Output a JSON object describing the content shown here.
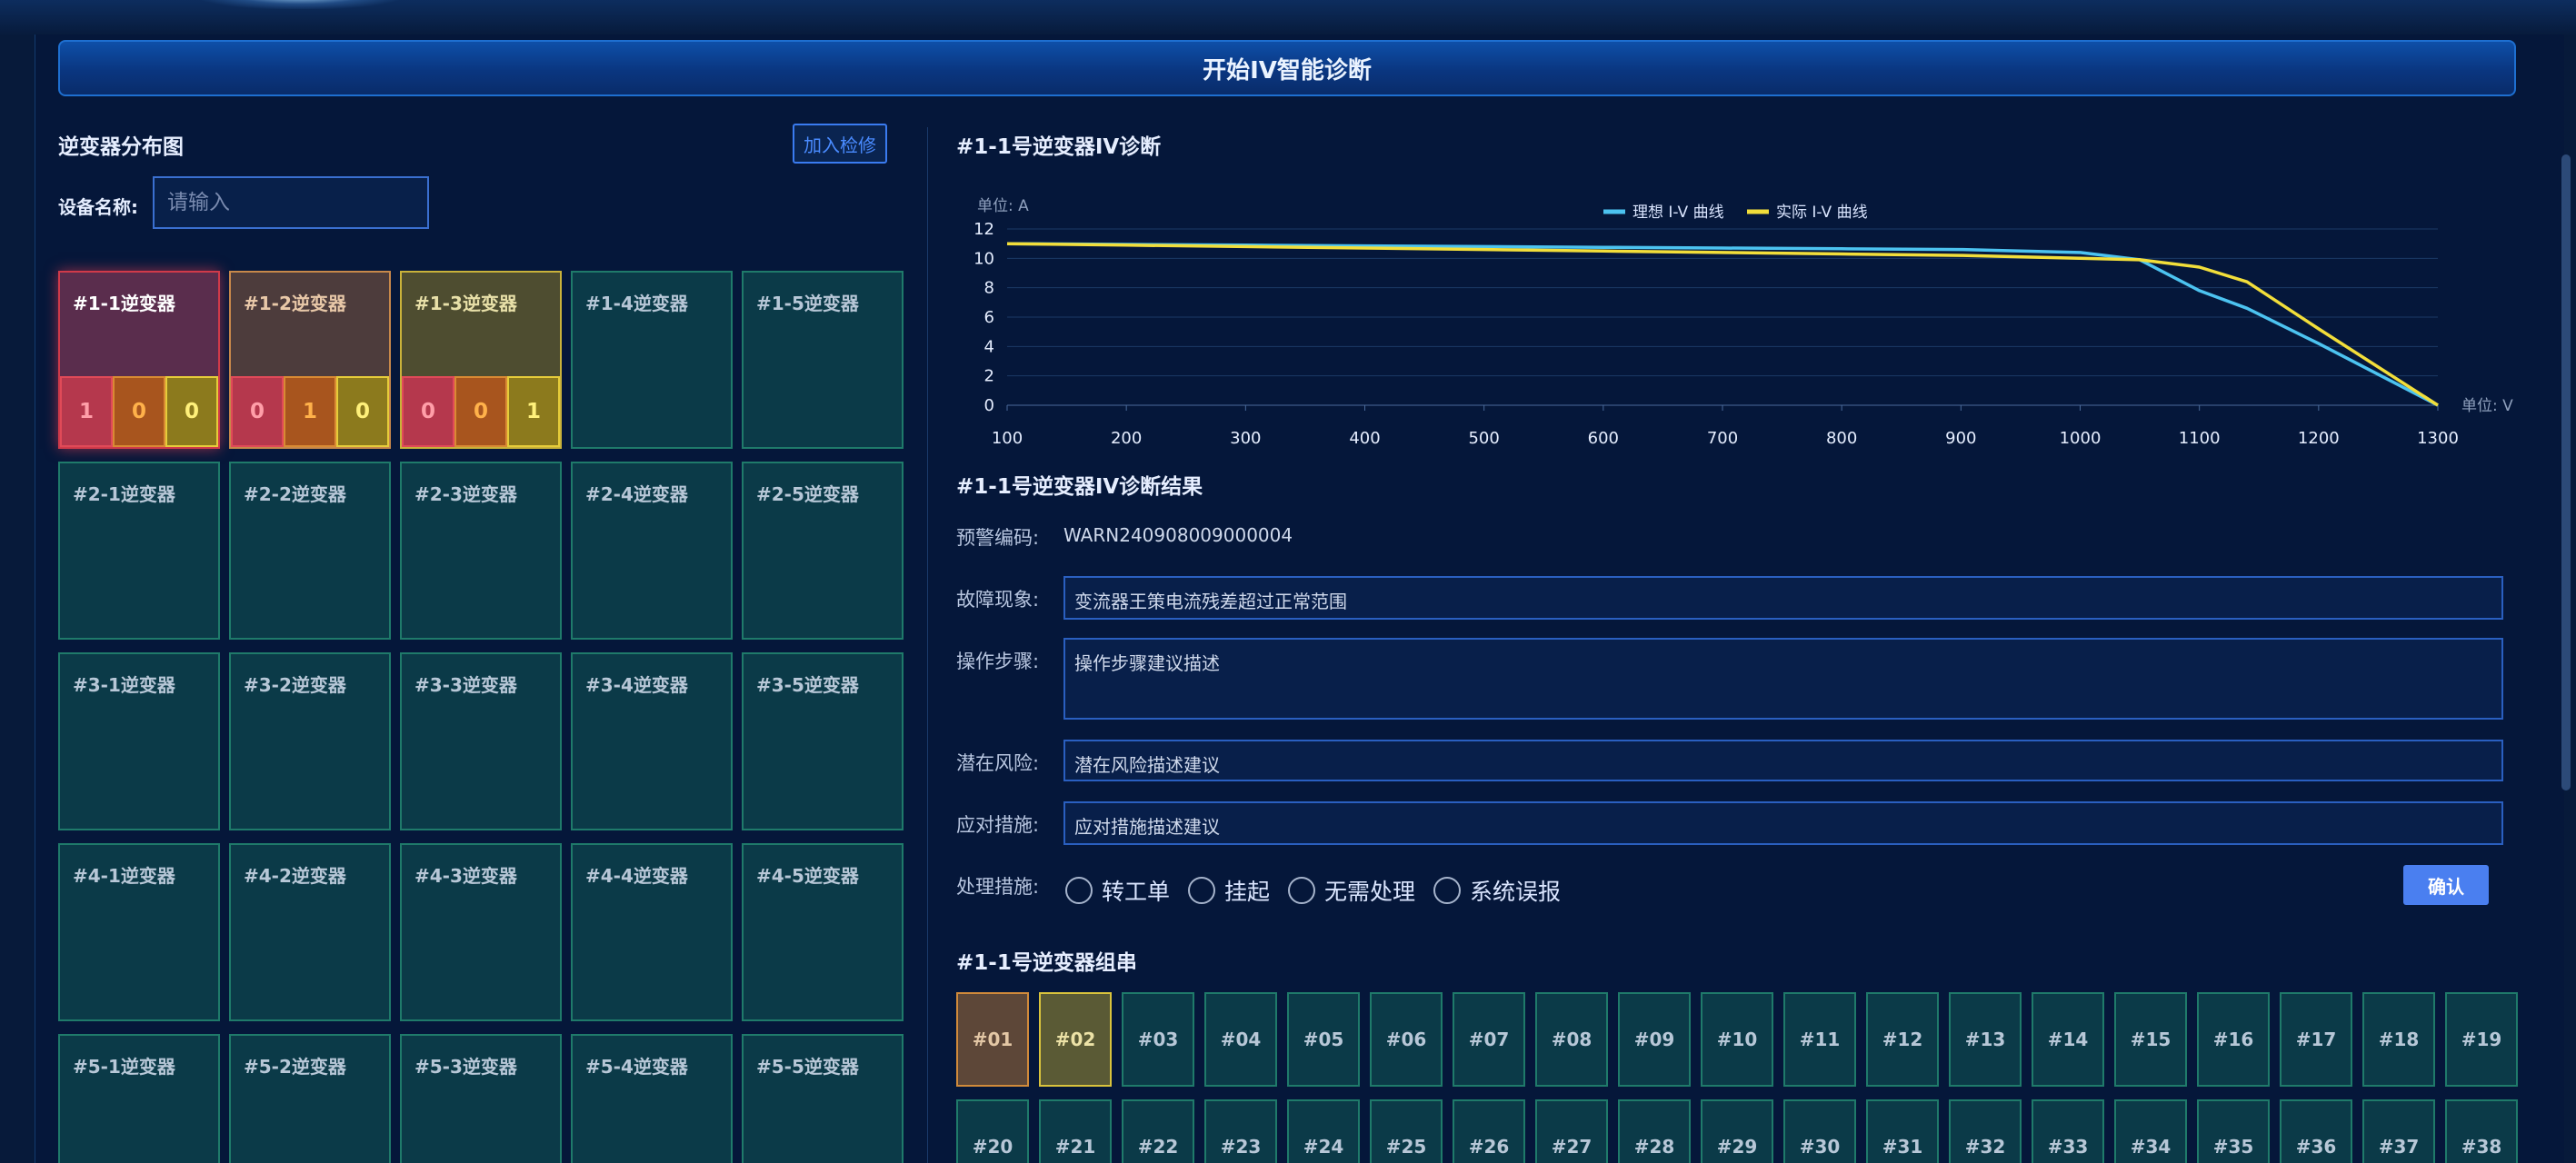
{
  "header": {
    "title": "开始IV智能诊断"
  },
  "left": {
    "title": "逆变器分布图",
    "repair_button": "加入检修",
    "device_label": "设备名称:",
    "device_placeholder": "请输入",
    "inverters": [
      {
        "label": "#1-1逆变器",
        "status": "red",
        "counts": [
          "1",
          "0",
          "0"
        ]
      },
      {
        "label": "#1-2逆变器",
        "status": "orange",
        "counts": [
          "0",
          "1",
          "0"
        ]
      },
      {
        "label": "#1-3逆变器",
        "status": "yellow",
        "counts": [
          "0",
          "0",
          "1"
        ]
      },
      {
        "label": "#1-4逆变器",
        "status": "normal"
      },
      {
        "label": "#1-5逆变器",
        "status": "normal"
      },
      {
        "label": "#2-1逆变器",
        "status": "normal"
      },
      {
        "label": "#2-2逆变器",
        "status": "normal"
      },
      {
        "label": "#2-3逆变器",
        "status": "normal"
      },
      {
        "label": "#2-4逆变器",
        "status": "normal"
      },
      {
        "label": "#2-5逆变器",
        "status": "normal"
      },
      {
        "label": "#3-1逆变器",
        "status": "normal"
      },
      {
        "label": "#3-2逆变器",
        "status": "normal"
      },
      {
        "label": "#3-3逆变器",
        "status": "normal"
      },
      {
        "label": "#3-4逆变器",
        "status": "normal"
      },
      {
        "label": "#3-5逆变器",
        "status": "normal"
      },
      {
        "label": "#4-1逆变器",
        "status": "normal"
      },
      {
        "label": "#4-2逆变器",
        "status": "normal"
      },
      {
        "label": "#4-3逆变器",
        "status": "normal"
      },
      {
        "label": "#4-4逆变器",
        "status": "normal"
      },
      {
        "label": "#4-5逆变器",
        "status": "normal"
      },
      {
        "label": "#5-1逆变器",
        "status": "normal"
      },
      {
        "label": "#5-2逆变器",
        "status": "normal"
      },
      {
        "label": "#5-3逆变器",
        "status": "normal"
      },
      {
        "label": "#5-4逆变器",
        "status": "normal"
      },
      {
        "label": "#5-5逆变器",
        "status": "normal"
      }
    ]
  },
  "right": {
    "diag_title": "#1-1号逆变器IV诊断",
    "result_title": "#1-1号逆变器IV诊断结果",
    "strings_title": "#1-1号逆变器组串",
    "warning_code_label": "预警编码:",
    "warning_code": "WARN240908009000004",
    "fault_label": "故障现象:",
    "fault_value": "变流器王策电流残差超过正常范围",
    "steps_label": "操作步骤:",
    "steps_value": "操作步骤建议描述",
    "risk_label": "潜在风险:",
    "risk_value": "潜在风险描述建议",
    "measure_label": "应对措施:",
    "measure_value": "应对措施描述建议",
    "handle_label": "处理措施:",
    "handle_options": [
      "转工单",
      "挂起",
      "无需处理",
      "系统误报"
    ],
    "confirm_button": "确认",
    "strings": [
      {
        "label": "#01",
        "status": "orange"
      },
      {
        "label": "#02",
        "status": "yellow"
      },
      {
        "label": "#03"
      },
      {
        "label": "#04"
      },
      {
        "label": "#05"
      },
      {
        "label": "#06"
      },
      {
        "label": "#07"
      },
      {
        "label": "#08"
      },
      {
        "label": "#09"
      },
      {
        "label": "#10"
      },
      {
        "label": "#11"
      },
      {
        "label": "#12"
      },
      {
        "label": "#13"
      },
      {
        "label": "#14"
      },
      {
        "label": "#15"
      },
      {
        "label": "#16"
      },
      {
        "label": "#17"
      },
      {
        "label": "#18"
      },
      {
        "label": "#19"
      },
      {
        "label": "#20"
      },
      {
        "label": "#21"
      },
      {
        "label": "#22"
      },
      {
        "label": "#23"
      },
      {
        "label": "#24"
      },
      {
        "label": "#25"
      },
      {
        "label": "#26"
      },
      {
        "label": "#27"
      },
      {
        "label": "#28"
      },
      {
        "label": "#29"
      },
      {
        "label": "#30"
      },
      {
        "label": "#31"
      },
      {
        "label": "#32"
      },
      {
        "label": "#33"
      },
      {
        "label": "#34"
      },
      {
        "label": "#35"
      },
      {
        "label": "#36"
      },
      {
        "label": "#37"
      },
      {
        "label": "#38"
      }
    ]
  },
  "chart_data": {
    "type": "line",
    "ylabel": "单位: A",
    "xlabel": "单位: V",
    "x": [
      100,
      200,
      300,
      400,
      500,
      600,
      700,
      800,
      900,
      1000,
      1050,
      1100,
      1140,
      1200,
      1300
    ],
    "xticks": [
      100,
      200,
      300,
      400,
      500,
      600,
      700,
      800,
      900,
      1000,
      1100,
      1200,
      1300
    ],
    "yticks": [
      0,
      2,
      4,
      6,
      8,
      10,
      12
    ],
    "xlim": [
      100,
      1300
    ],
    "ylim": [
      0,
      12
    ],
    "legend_position": "top-center",
    "series": [
      {
        "name": "理想 I-V 曲线",
        "color": "#4cc3f0",
        "values": [
          11.0,
          10.95,
          10.9,
          10.85,
          10.8,
          10.75,
          10.7,
          10.65,
          10.6,
          10.4,
          9.9,
          7.8,
          6.6,
          4.2,
          0
        ]
      },
      {
        "name": "实际 I-V 曲线",
        "color": "#f2de3a",
        "values": [
          11.0,
          10.9,
          10.8,
          10.7,
          10.6,
          10.5,
          10.4,
          10.3,
          10.2,
          10.0,
          9.9,
          9.4,
          8.4,
          5.2,
          0
        ]
      }
    ]
  }
}
